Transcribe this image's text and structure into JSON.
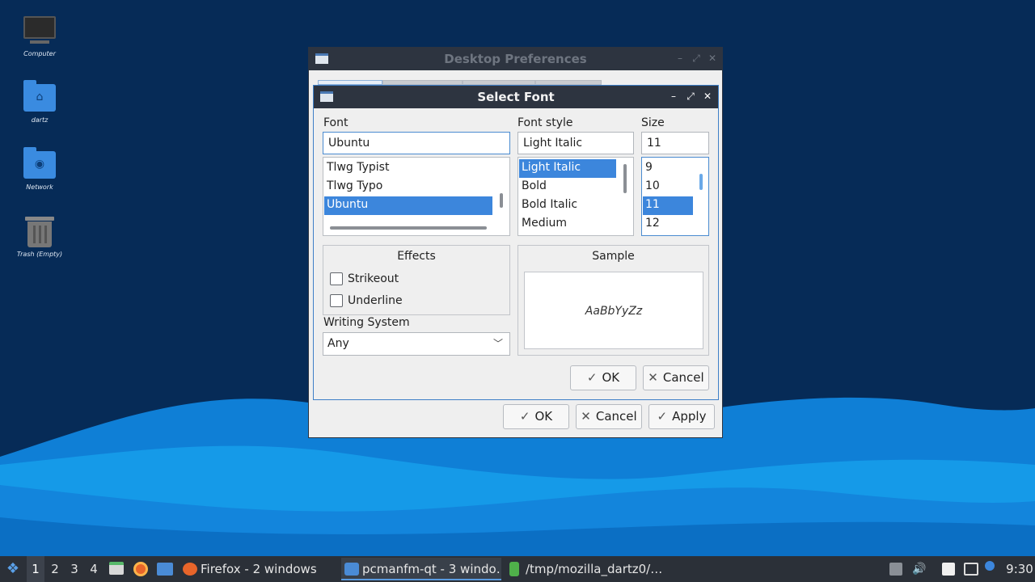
{
  "desktop": {
    "icons": [
      {
        "label": "Computer",
        "icon": "monitor-icon"
      },
      {
        "label": "dartz",
        "icon": "home-folder-icon"
      },
      {
        "label": "Network",
        "icon": "network-folder-icon"
      },
      {
        "label": "Trash (Empty)",
        "icon": "trash-icon"
      }
    ]
  },
  "prefs_window": {
    "title": "Desktop Preferences",
    "buttons": {
      "ok": "OK",
      "cancel": "Cancel",
      "apply": "Apply"
    }
  },
  "font_dialog": {
    "title": "Select Font",
    "font_label": "Font",
    "font_value": "Ubuntu",
    "font_list": [
      "Tlwg Typist",
      "Tlwg Typo",
      "Ubuntu"
    ],
    "font_selected_index": 2,
    "style_label": "Font style",
    "style_value": "Light Italic",
    "style_list": [
      "Light Italic",
      "Bold",
      "Bold Italic",
      "Medium"
    ],
    "style_selected_index": 0,
    "size_label": "Size",
    "size_value": "11",
    "size_list": [
      "9",
      "10",
      "11",
      "12"
    ],
    "size_selected_index": 2,
    "effects_title": "Effects",
    "strikeout_label": "Strikeout",
    "underline_label": "Underline",
    "strikeout_checked": false,
    "underline_checked": false,
    "writing_system_label": "Writing System",
    "writing_system_value": "Any",
    "sample_title": "Sample",
    "sample_text": "AaBbYyZz",
    "buttons": {
      "ok": "OK",
      "cancel": "Cancel"
    }
  },
  "taskbar": {
    "workspaces": [
      "1",
      "2",
      "3",
      "4"
    ],
    "active_workspace": "1",
    "tasks": [
      {
        "label": "Firefox - 2 windows",
        "icon": "firefox-icon"
      },
      {
        "label": "pcmanfm-qt - 3 windo…",
        "icon": "folder-icon"
      },
      {
        "label": "/tmp/mozilla_dartz0/…",
        "icon": "archive-icon"
      }
    ],
    "clock": "9:30"
  },
  "colors": {
    "selection": "#3c86dc",
    "titlebar": "#2d3440",
    "taskbar": "#2b3038",
    "desktop": "#082a58"
  }
}
